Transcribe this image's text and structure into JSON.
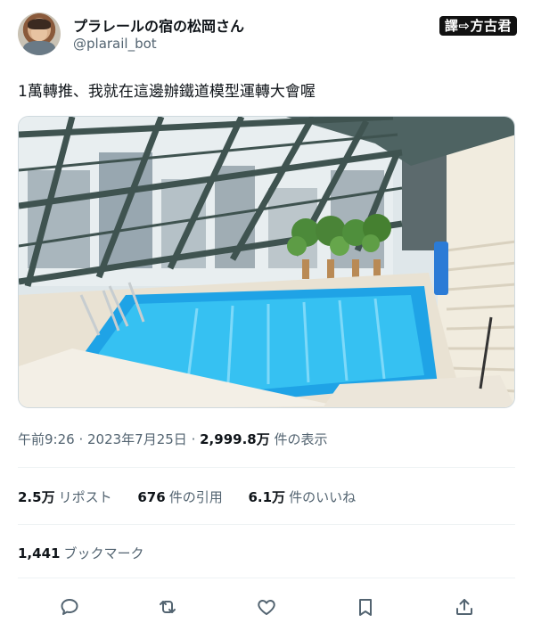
{
  "author": {
    "display_name": "プラレールの宿の松岡さん",
    "handle": "@plarail_bot",
    "avatar_icon": "user-avatar"
  },
  "translate_badge": "譯⇨方古君",
  "tweet": {
    "text": "1萬轉推、我就在這邊辦鐵道模型運轉大會喔",
    "media_description": "indoor-pool-with-glass-roof"
  },
  "meta": {
    "time": "午前9:26",
    "separator1": " · ",
    "date": "2023年7月25日",
    "separator2": " · ",
    "views_count": "2,999.8万",
    "views_label": " 件の表示"
  },
  "stats": {
    "reposts_count": "2.5万",
    "reposts_label": "リポスト",
    "quotes_count": "676",
    "quotes_label": "件の引用",
    "likes_count": "6.1万",
    "likes_label": "件のいいね",
    "bookmarks_count": "1,441",
    "bookmarks_label": "ブックマーク"
  },
  "actions": {
    "reply_icon": "reply-icon",
    "repost_icon": "repost-icon",
    "like_icon": "like-icon",
    "bookmark_icon": "bookmark-icon",
    "share_icon": "share-icon"
  },
  "colors": {
    "text_primary": "#0f1419",
    "text_secondary": "#536471",
    "divider": "#eff3f4",
    "pool_water": "#27b4ee"
  }
}
